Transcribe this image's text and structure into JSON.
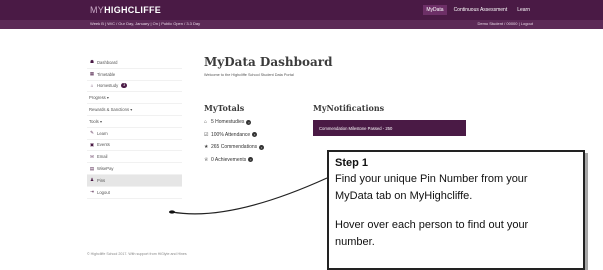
{
  "header": {
    "logo_prefix": "MY",
    "logo_main": "HIGHCLIFFE",
    "nav": [
      "MyData",
      "Continuous Assessment",
      "Learn"
    ],
    "subbar_left": "Week B | W/C / Our Day, January | On | Public Open / 3.3 Day",
    "subbar_right": "Demo Student / 00000 | Logout"
  },
  "sidebar": {
    "items": [
      {
        "icon": "dashboard-icon",
        "glyph": "☗",
        "label": "Dashboard"
      },
      {
        "icon": "timetable-icon",
        "glyph": "▦",
        "label": "Timetable"
      },
      {
        "icon": "homestudy-icon",
        "glyph": "⌂",
        "label": "Homestudy",
        "badge": "3"
      },
      {
        "icon": "",
        "glyph": "",
        "label": "Progress ▾"
      },
      {
        "icon": "",
        "glyph": "",
        "label": "Rewards & Sanctions ▾"
      },
      {
        "icon": "",
        "glyph": "",
        "label": "Tools ▾"
      },
      {
        "icon": "learn-icon",
        "glyph": "✎",
        "label": "Learn"
      },
      {
        "icon": "events-icon",
        "glyph": "▣",
        "label": "Events"
      },
      {
        "icon": "email-icon",
        "glyph": "✉",
        "label": "Email"
      },
      {
        "icon": "wisepay-icon",
        "glyph": "▤",
        "label": "WisePay"
      },
      {
        "icon": "pins-icon",
        "glyph": "♟",
        "label": "Pins"
      },
      {
        "icon": "logout-icon",
        "glyph": "⇥",
        "label": "Logout"
      }
    ],
    "footer": "© Highcliffe School 2017. With support from HiGlyte and Hines"
  },
  "main": {
    "title": "MyData Dashboard",
    "subtitle": "Welcome to the Highcliffe School Student Data Portal",
    "totals_title": "MyTotals",
    "totals": [
      {
        "icon": "homestudies-icon",
        "glyph": "⌂",
        "label": "5 Homestudies"
      },
      {
        "icon": "attendance-icon",
        "glyph": "☑",
        "label": "100% Attendance"
      },
      {
        "icon": "commendations-icon",
        "glyph": "★",
        "label": "265 Commendations"
      },
      {
        "icon": "achievements-icon",
        "glyph": "♕",
        "label": "0 Achievements"
      }
    ],
    "notifications_title": "MyNotifications",
    "notifications": [
      "Commendation Milestone Passed - 250"
    ]
  },
  "callout": {
    "step": "Step 1",
    "lines": [
      "Find your unique Pin Number from your",
      "MyData tab on MyHighcliffe."
    ],
    "lines2": [
      "Hover over each person to find out your",
      "number."
    ]
  },
  "colors": {
    "brand": "#4a1a45",
    "brand_light": "#5c2a57"
  }
}
